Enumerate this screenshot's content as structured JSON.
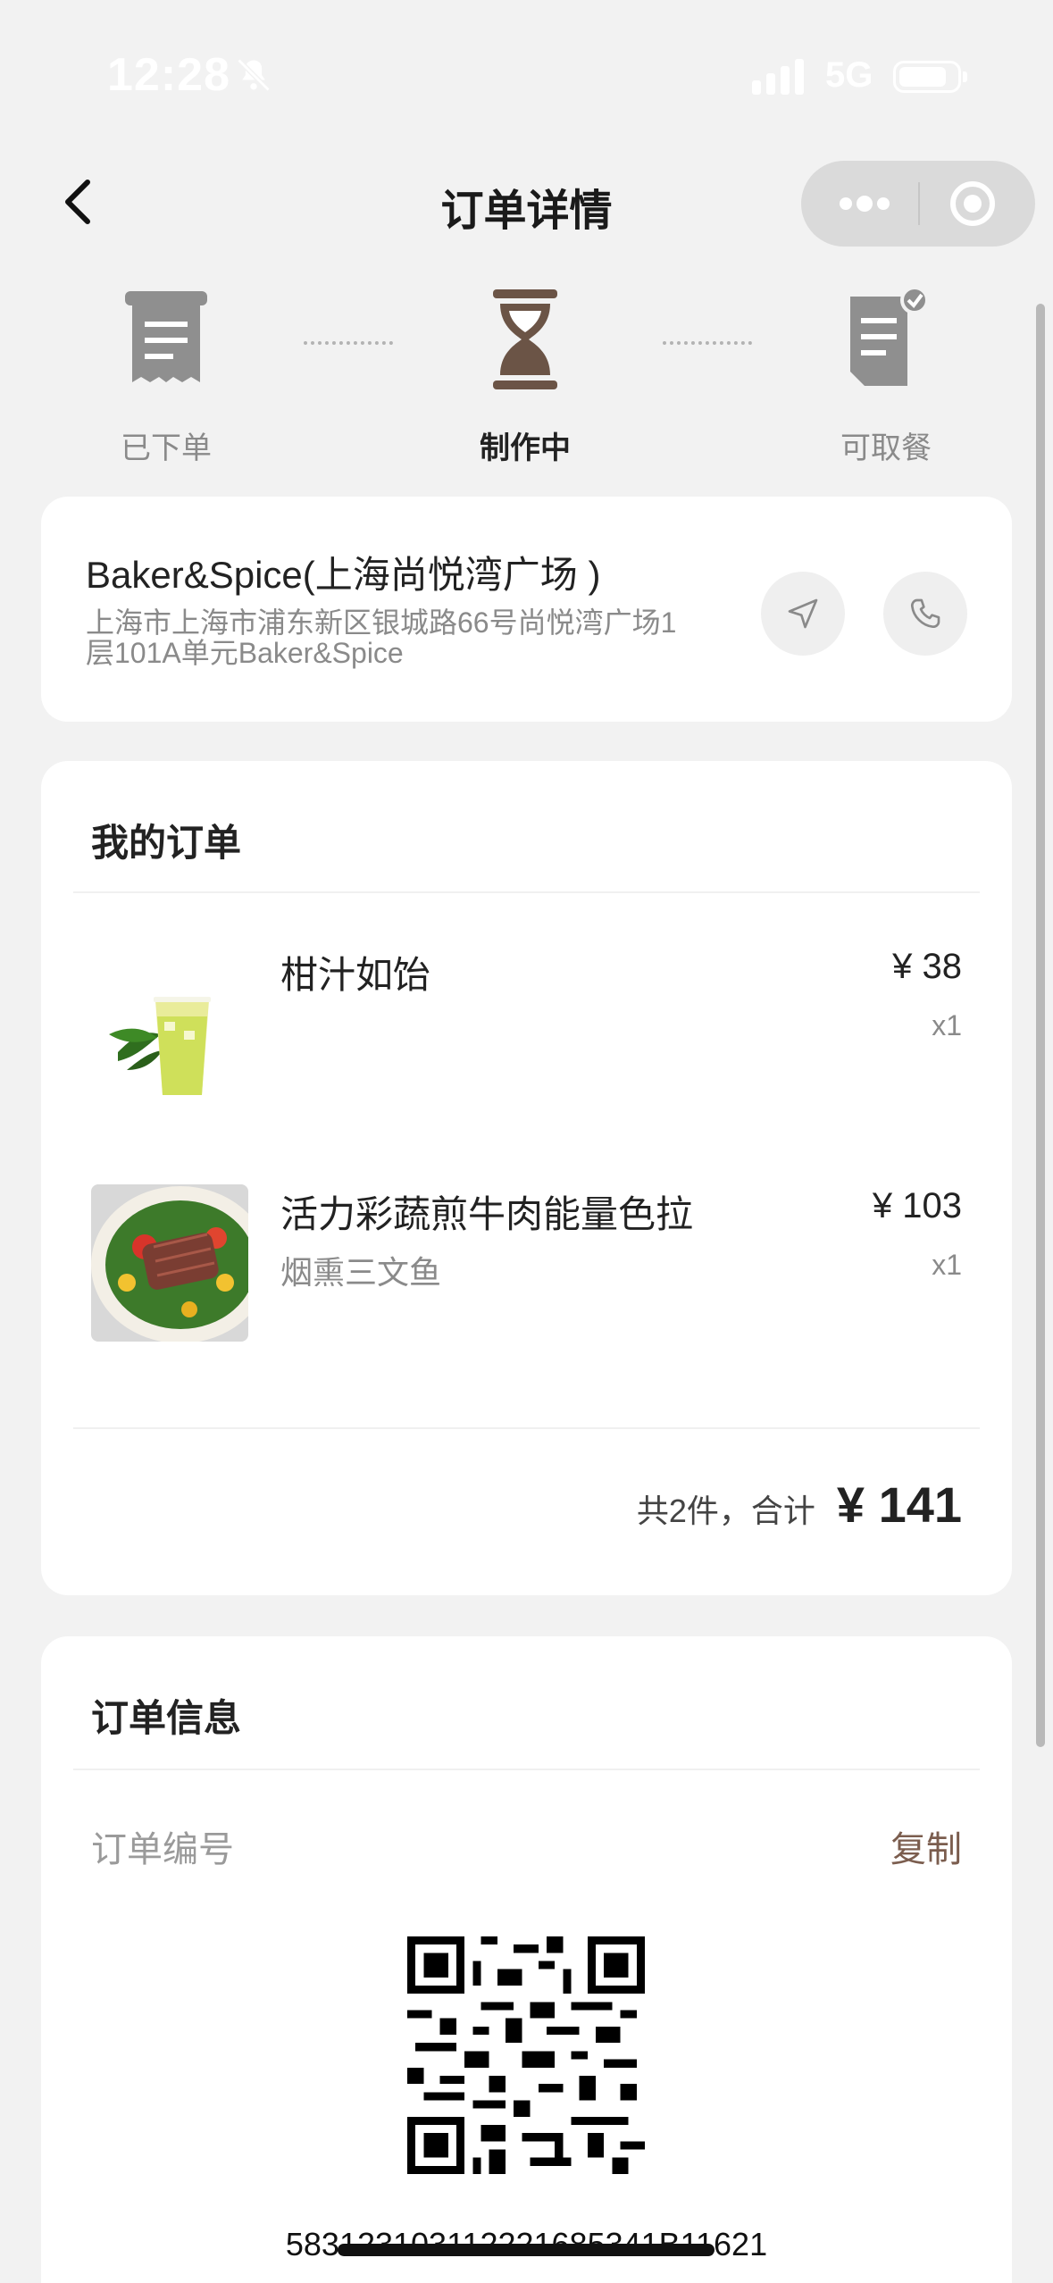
{
  "status_bar": {
    "time": "12:28",
    "network": "5G",
    "icons": [
      "bell-muted-icon",
      "signal-icon",
      "battery-icon"
    ]
  },
  "nav": {
    "title": "订单详情",
    "back_icon": "chevron-left-icon",
    "capsule_icons": [
      "more-dots-icon",
      "target-icon"
    ]
  },
  "steps": [
    {
      "label": "已下单",
      "icon": "receipt-icon",
      "state": "done"
    },
    {
      "label": "制作中",
      "icon": "hourglass-icon",
      "state": "active"
    },
    {
      "label": "可取餐",
      "icon": "document-check-icon",
      "state": "pending"
    }
  ],
  "store": {
    "name": "Baker&Spice(上海尚悦湾广场 )",
    "address_line1": "上海市上海市浦东新区银城路66号尚悦湾广场1",
    "address_line2": "层101A单元Baker&Spice",
    "actions": [
      "navigate-icon",
      "phone-icon"
    ]
  },
  "order": {
    "title": "我的订单",
    "items": [
      {
        "name": "柑汁如饴",
        "spec": "",
        "price": "¥ 38",
        "qty": "x1"
      },
      {
        "name": "活力彩蔬煎牛肉能量色拉",
        "spec": "烟熏三文鱼",
        "price": "¥ 103",
        "qty": "x1"
      }
    ],
    "total_count": "共2件，合计",
    "total_sum": "¥ 141"
  },
  "info": {
    "title": "订单信息",
    "order_no_label": "订单编号",
    "copy_label": "复制",
    "order_no": "583123103112221685341B11621"
  },
  "colors": {
    "background": "#f2f2f2",
    "accent_brown": "#7b5d4e",
    "icon_brown": "#6b5446"
  }
}
